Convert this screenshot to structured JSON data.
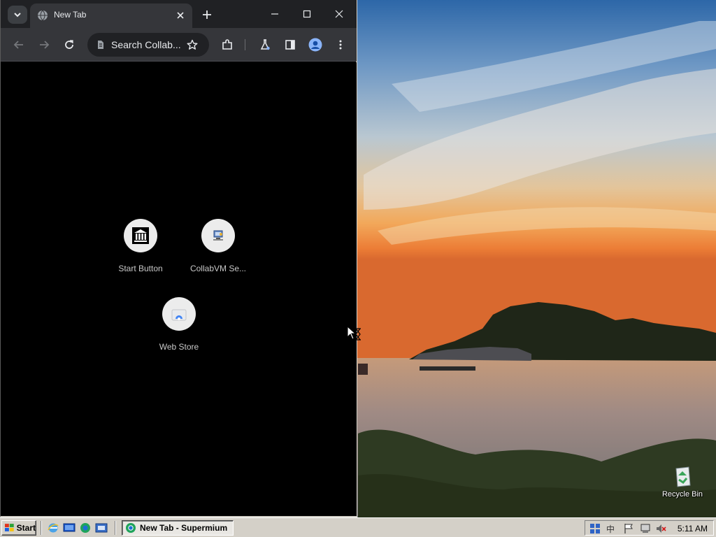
{
  "browser": {
    "tab_title": "New Tab",
    "omnibox_placeholder": "Search Collab...",
    "shortcuts": [
      {
        "label": "Start Button",
        "icon": "museum-icon"
      },
      {
        "label": "CollabVM Se...",
        "icon": "collabvm-icon"
      },
      {
        "label": "Web Store",
        "icon": "web-store-icon"
      }
    ]
  },
  "desktop": {
    "icons": [
      {
        "label": "Recycle Bin",
        "icon": "recycle-bin-icon"
      }
    ]
  },
  "taskbar": {
    "start_label": "Start",
    "tasks": [
      {
        "label": "New Tab - Supermium",
        "icon": "supermium-icon"
      }
    ],
    "clock": "5:11 AM"
  },
  "colors": {
    "tabstrip": "#202124",
    "toolbar": "#35363a",
    "taskbar": "#d4d0c8"
  }
}
